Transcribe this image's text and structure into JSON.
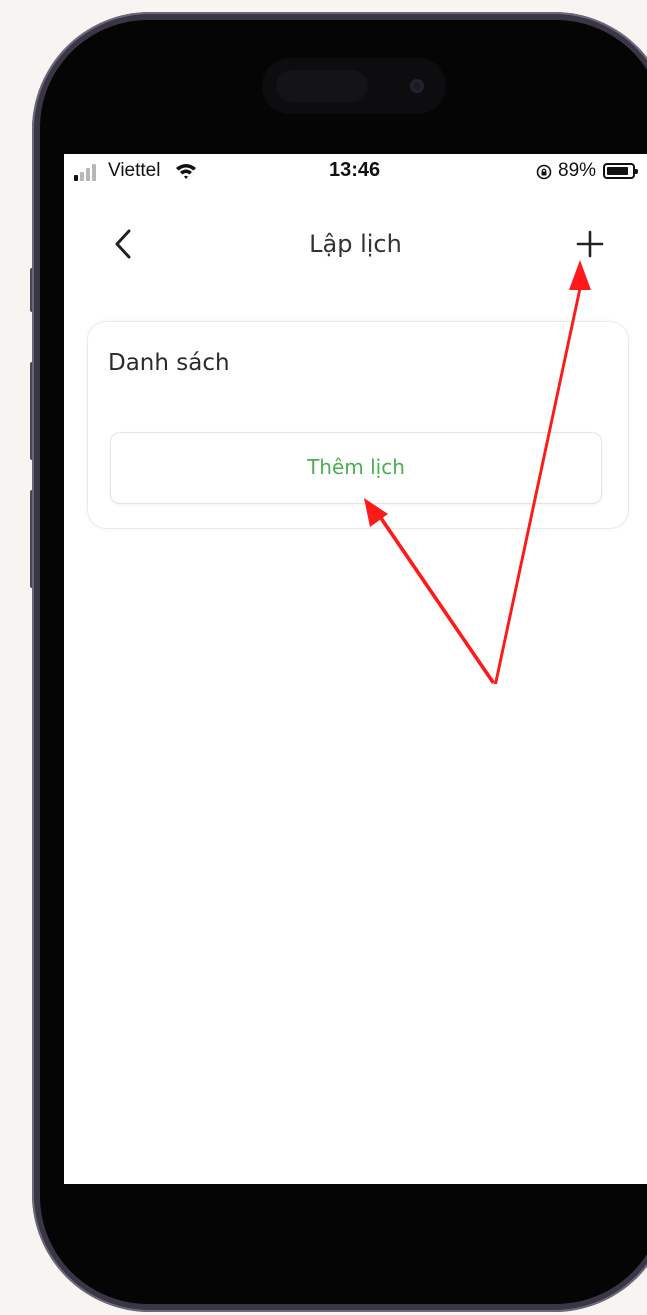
{
  "status_bar": {
    "carrier": "Viettel",
    "time": "13:46",
    "battery_percent": "89%",
    "battery_level": 0.89,
    "signal_icon": "cellular-signal-icon",
    "wifi_icon": "wifi-icon",
    "rotation_lock_icon": "rotation-lock-icon"
  },
  "header": {
    "title": "Lập lịch",
    "back_icon": "chevron-left-icon",
    "add_icon": "plus-icon"
  },
  "schedule_list": {
    "title": "Danh sách",
    "add_button_label": "Thêm lịch"
  },
  "colors": {
    "accent_green": "#4caf50",
    "annotation_red": "#ff1a1a",
    "text_dark": "#333333",
    "phone_frame": "#3a3646"
  }
}
